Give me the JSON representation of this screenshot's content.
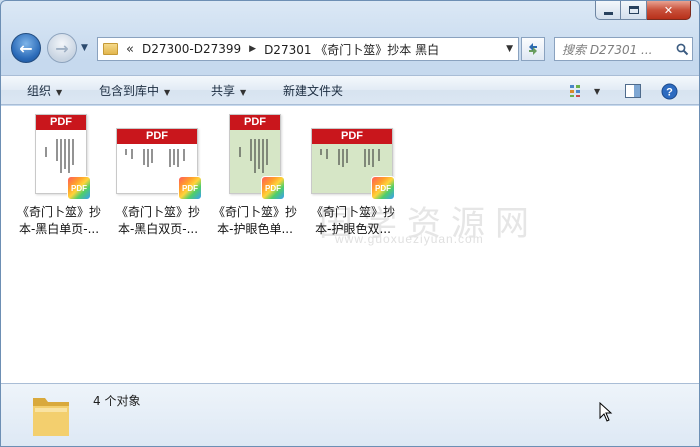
{
  "window": {
    "caption": {
      "minimize": "minimize",
      "maximize": "maximize",
      "close": "✕"
    }
  },
  "address": {
    "overflow_glyph": "«",
    "crumbs": [
      "D27300-D27399",
      "D27301 《奇门卜筮》抄本 黑白"
    ]
  },
  "search": {
    "placeholder": "搜索 D27301 ..."
  },
  "toolbar": {
    "organize": "组织",
    "include_in_library": "包含到库中",
    "share": "共享",
    "new_folder": "新建文件夹"
  },
  "files": [
    {
      "name": "《奇门卜筮》抄本-黑白单页-...",
      "thumb_header": "PDF",
      "layout": "single",
      "paper": "white",
      "badge": "PDF"
    },
    {
      "name": "《奇门卜筮》抄本-黑白双页-...",
      "thumb_header": "PDF",
      "layout": "double",
      "paper": "white",
      "badge": "PDF"
    },
    {
      "name": "《奇门卜筮》抄本-护眼色单...",
      "thumb_header": "PDF",
      "layout": "single",
      "paper": "green",
      "badge": "PDF"
    },
    {
      "name": "《奇门卜筮》抄本-护眼色双...",
      "thumb_header": "PDF",
      "layout": "double",
      "paper": "green",
      "badge": "PDF"
    }
  ],
  "watermark": {
    "text": "国学资源网",
    "url": "www.guoxueziyuan.com"
  },
  "status": {
    "item_count": "4 个对象"
  },
  "colors": {
    "pdf_red": "#c9161c",
    "eye_care_green": "#d6e6c6",
    "accent_blue": "#2a6ab8"
  }
}
